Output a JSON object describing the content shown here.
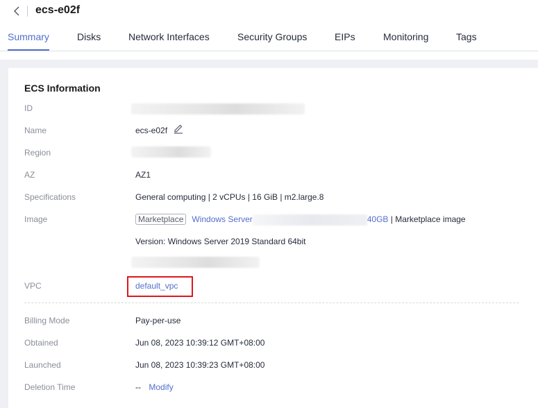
{
  "header": {
    "title": "ecs-e02f"
  },
  "tabs": [
    {
      "label": "Summary"
    },
    {
      "label": "Disks"
    },
    {
      "label": "Network Interfaces"
    },
    {
      "label": "Security Groups"
    },
    {
      "label": "EIPs"
    },
    {
      "label": "Monitoring"
    },
    {
      "label": "Tags"
    }
  ],
  "card": {
    "title": "ECS Information",
    "rows": {
      "id": {
        "label": "ID"
      },
      "name": {
        "label": "Name",
        "value": "ecs-e02f"
      },
      "region": {
        "label": "Region"
      },
      "az": {
        "label": "AZ",
        "value": "AZ1"
      },
      "specs": {
        "label": "Specifications",
        "value": "General computing | 2 vCPUs | 16 GiB | m2.large.8"
      },
      "image": {
        "label": "Image",
        "tag": "Marketplace",
        "link_start": "Windows Server",
        "link_end": "40GB",
        "suffix": " | Marketplace image",
        "version": "Version: Windows Server 2019 Standard 64bit"
      },
      "vpc": {
        "label": "VPC",
        "value": "default_vpc"
      },
      "billing": {
        "label": "Billing Mode",
        "value": "Pay-per-use"
      },
      "obtained": {
        "label": "Obtained",
        "value": "Jun 08, 2023 10:39:12 GMT+08:00"
      },
      "launched": {
        "label": "Launched",
        "value": "Jun 08, 2023 10:39:23 GMT+08:00"
      },
      "deletion": {
        "label": "Deletion Time",
        "value": "--",
        "action": "Modify"
      }
    }
  },
  "colors": {
    "accent": "#526ecc",
    "highlight": "#e1141c"
  }
}
